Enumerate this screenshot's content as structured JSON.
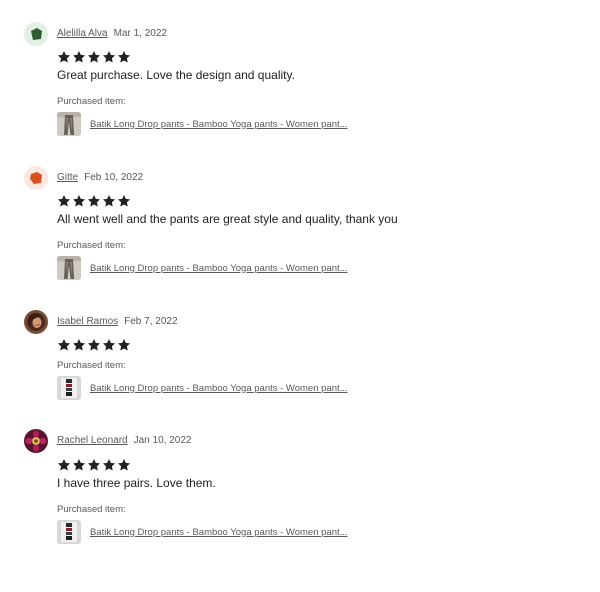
{
  "reviews": [
    {
      "reviewer": "Alelilla Alva",
      "date": "Mar 1, 2022",
      "rating": 5,
      "text": "Great purchase. Love the design and quality.",
      "purchased_label": "Purchased item:",
      "item_title": "Batik Long Drop pants - Bamboo Yoga pants - Women pant...",
      "avatar_icon": "green-shape-avatar",
      "thumbnail": "grey-pants-photo"
    },
    {
      "reviewer": "Gitte",
      "date": "Feb 10, 2022",
      "rating": 5,
      "text": "All went well and the pants are great style and quality, thank you",
      "purchased_label": "Purchased item:",
      "item_title": "Batik Long Drop pants - Bamboo Yoga pants - Women pant...",
      "avatar_icon": "orange-shape-avatar",
      "thumbnail": "grey-pants-photo"
    },
    {
      "reviewer": "Isabel Ramos",
      "date": "Feb 7, 2022",
      "rating": 5,
      "text": "",
      "purchased_label": "Purchased item:",
      "item_title": "Batik Long Drop pants - Bamboo Yoga pants - Women pant...",
      "avatar_icon": "profile-photo-avatar",
      "thumbnail": "folded-pants-photo"
    },
    {
      "reviewer": "Rachel Leonard",
      "date": "Jan 10, 2022",
      "rating": 5,
      "text": "I have three pairs. Love them.",
      "purchased_label": "Purchased item:",
      "item_title": "Batik Long Drop pants - Bamboo Yoga pants - Women pant...",
      "avatar_icon": "flower-photo-avatar",
      "thumbnail": "folded-pants-photo"
    }
  ],
  "colors": {
    "text": "#222222",
    "muted": "#595959",
    "star": "#222222",
    "avatar_green": "#2f5d34",
    "avatar_orange": "#d6501e"
  }
}
